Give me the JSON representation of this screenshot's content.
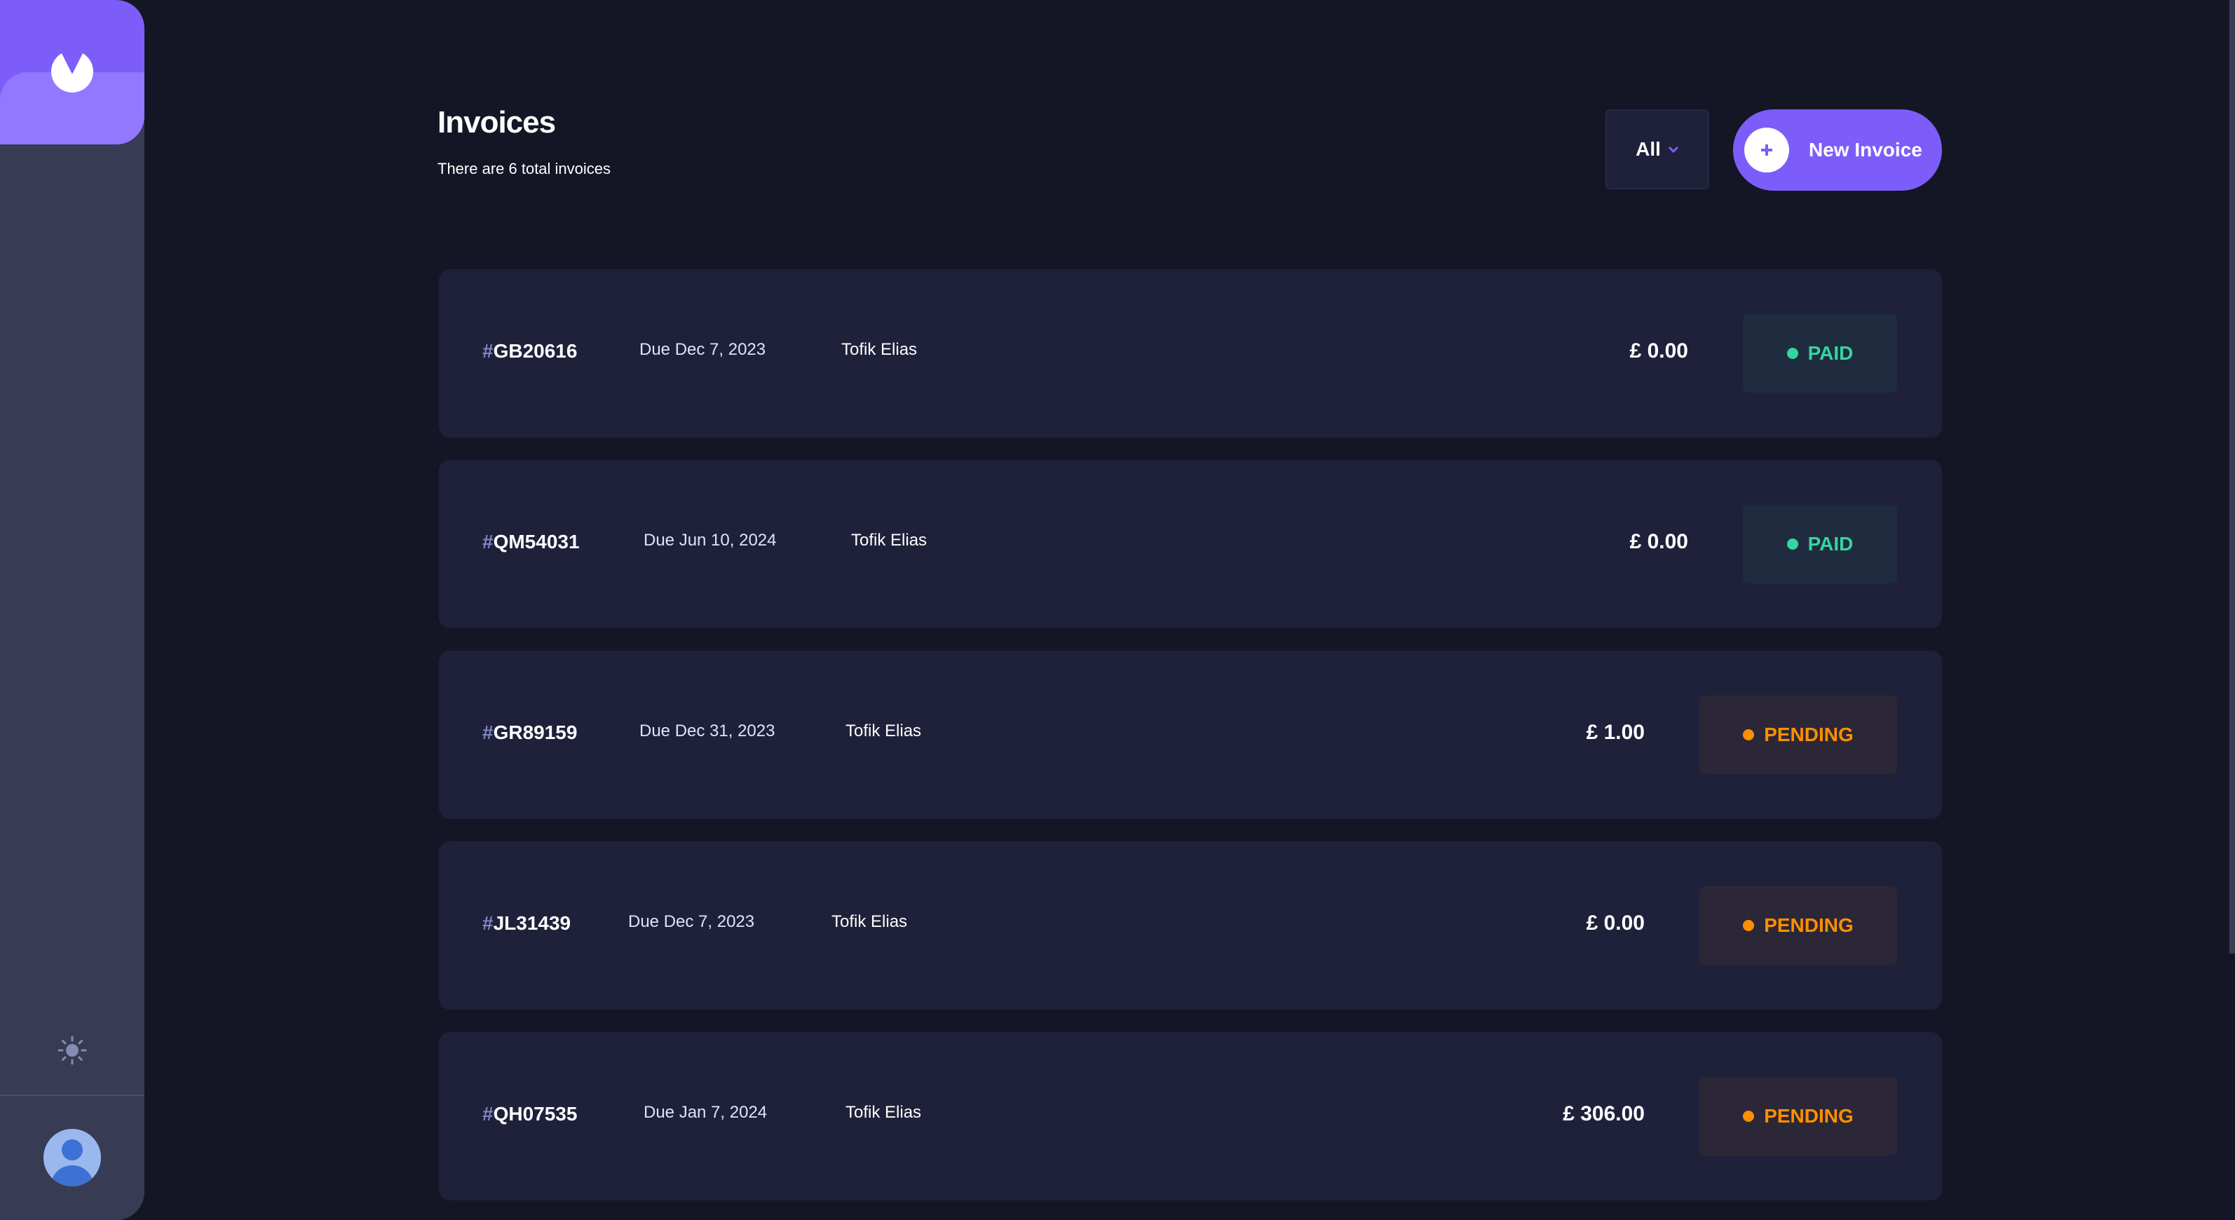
{
  "sidebar": {
    "logo_icon": "logo-icon",
    "theme_icon": "sun-icon",
    "avatar_icon": "user-avatar-icon"
  },
  "header": {
    "title": "Invoices",
    "subtitle": "There are 6 total invoices",
    "filter_label": "All",
    "new_invoice_label": "New Invoice"
  },
  "colors": {
    "accent": "#7c5dfa",
    "background": "#141625",
    "card": "#1f213a",
    "paid": "#33d69f",
    "pending": "#ff8f00"
  },
  "invoices": [
    {
      "hash": "#",
      "id": "GB20616",
      "due": "Due Dec 7, 2023",
      "client": "Tofik Elias",
      "amount": "£ 0.00",
      "status": "PAID"
    },
    {
      "hash": "#",
      "id": "QM54031",
      "due": "Due Jun 10, 2024",
      "client": "Tofik Elias",
      "amount": "£ 0.00",
      "status": "PAID"
    },
    {
      "hash": "#",
      "id": "GR89159",
      "due": "Due Dec 31, 2023",
      "client": "Tofik Elias",
      "amount": "£ 1.00",
      "status": "PENDING"
    },
    {
      "hash": "#",
      "id": "JL31439",
      "due": "Due Dec 7, 2023",
      "client": "Tofik Elias",
      "amount": "£ 0.00",
      "status": "PENDING"
    },
    {
      "hash": "#",
      "id": "QH07535",
      "due": "Due Jan 7, 2024",
      "client": "Tofik Elias",
      "amount": "£ 306.00",
      "status": "PENDING"
    }
  ]
}
